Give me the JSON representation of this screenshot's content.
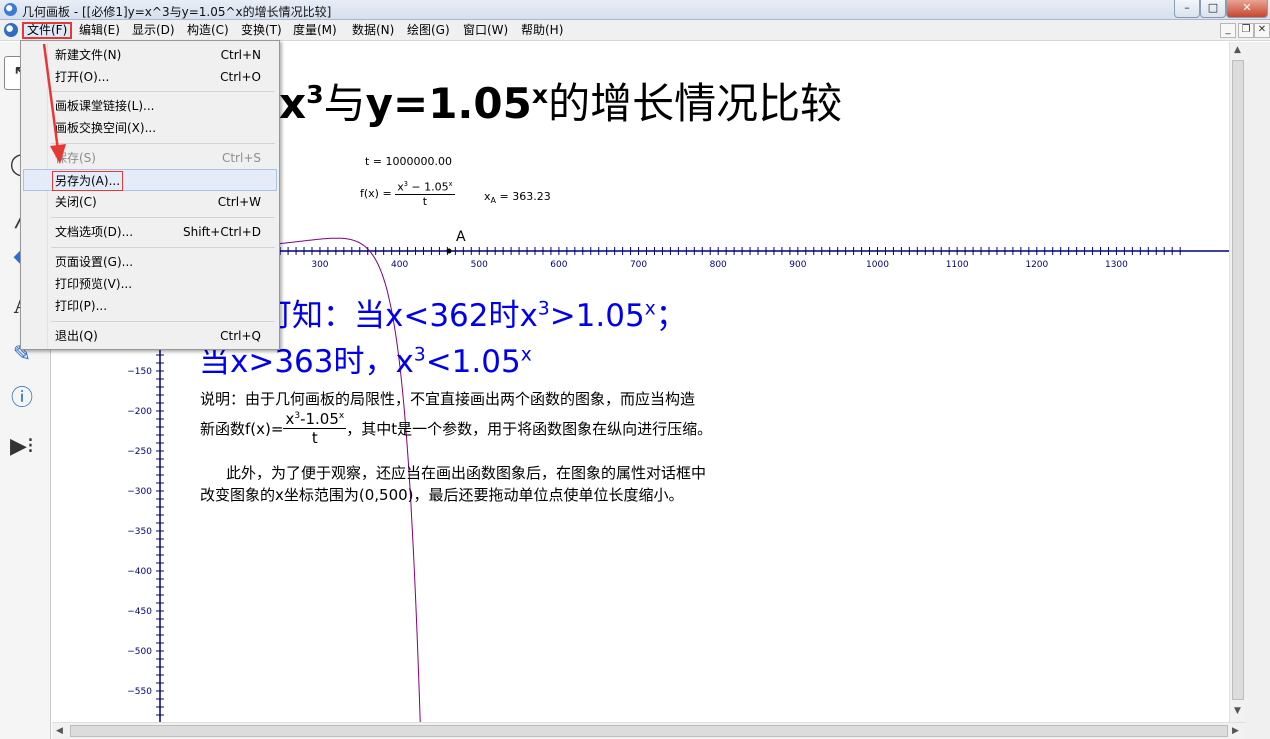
{
  "window": {
    "title": "几何画板 - [[必修1]y=x^3与y=1.05^x的增长情况比较]"
  },
  "menubar": {
    "items": [
      "文件(F)",
      "编辑(E)",
      "显示(D)",
      "构造(C)",
      "变换(T)",
      "度量(M)",
      "数据(N)",
      "绘图(G)",
      "窗口(W)",
      "帮助(H)"
    ],
    "active_index": 0
  },
  "file_menu": {
    "items": [
      {
        "label": "新建文件(N)",
        "shortcut": "Ctrl+N"
      },
      {
        "label": "打开(O)...",
        "shortcut": "Ctrl+O"
      },
      {
        "label": "画板课堂链接(L)...",
        "shortcut": ""
      },
      {
        "label": "画板交换空间(X)...",
        "shortcut": ""
      },
      {
        "label": "保存(S)",
        "shortcut": "Ctrl+S",
        "disabled": true
      },
      {
        "label": "另存为(A)...",
        "shortcut": "",
        "highlighted": true
      },
      {
        "label": "关闭(C)",
        "shortcut": "Ctrl+W"
      },
      {
        "label": "文档选项(D)...",
        "shortcut": "Shift+Ctrl+D"
      },
      {
        "label": "页面设置(G)...",
        "shortcut": ""
      },
      {
        "label": "打印预览(V)...",
        "shortcut": ""
      },
      {
        "label": "打印(P)...",
        "shortcut": ""
      },
      {
        "label": "退出(Q)",
        "shortcut": "Ctrl+Q"
      }
    ]
  },
  "toolbar": {
    "tools": [
      "arrow-tool",
      "point-tool",
      "compass-tool",
      "line-tool",
      "polygon-tool",
      "text-tool",
      "marker-tool",
      "info-tool",
      "custom-tool"
    ]
  },
  "sketch": {
    "title_prefix": "x",
    "title_sup1": "3",
    "title_mid": "与",
    "title_y": "y=1.05",
    "title_sup2": "x",
    "title_end": "的增长情况比较",
    "t_value": "t = 1000000.00",
    "fx_label": "f(x) =",
    "fx_num_a": "x",
    "fx_num_sup": "3",
    "fx_num_b": " − 1.05",
    "fx_num_sup2": "x",
    "fx_den": "t",
    "xa_label": "x",
    "xa_sub": "A",
    "xa_value": " = 363.23",
    "point_label": "A",
    "conclusion_1a": "上图可知：当x<362时x",
    "conclusion_1sup": "3",
    "conclusion_1b": ">1.05",
    "conclusion_1sup2": "x",
    "conclusion_1c": "；",
    "conclusion_2a": "当x>363时，x",
    "conclusion_2sup": "3",
    "conclusion_2b": "<1.05",
    "conclusion_2sup2": "x",
    "note_1": "说明：由于几何画板的局限性，不宜直接画出两个函数的图象，而应当构造",
    "note_2a": "新函数f(x)=",
    "note_2_num": "x",
    "note_2_num_sup": "3",
    "note_2_num_b": "-1.05",
    "note_2_num_sup2": "x",
    "note_2_den": "t",
    "note_2b": "，其中t是一个参数，用于将函数图象在纵向进行压缩。",
    "note_3": "此外，为了便于观察，还应当在画出函数图象后，在图象的属性对话框中",
    "note_4": "改变图象的x坐标范围为(0,500)，最后还要拖动单位点使单位长度缩小。"
  },
  "axes": {
    "x_ticks": [
      200,
      300,
      400,
      500,
      600,
      700,
      800,
      900,
      1000,
      1100,
      1200,
      1300
    ],
    "y_ticks": [
      -150,
      -200,
      -250,
      -300,
      -350,
      -400,
      -450,
      -500,
      -550
    ]
  },
  "colors": {
    "accent": "#0000ee",
    "curve": "#800080",
    "axis": "#000080",
    "highlight": "#e53935"
  }
}
